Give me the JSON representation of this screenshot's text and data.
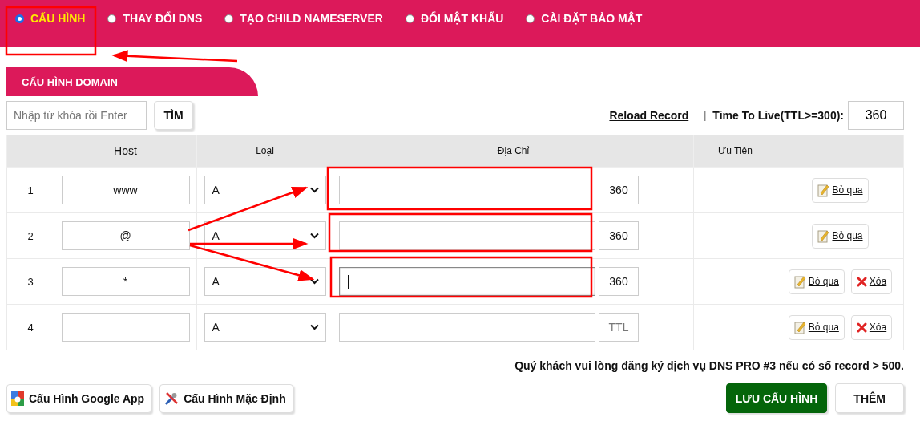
{
  "tabs": [
    {
      "label": "CẤU HÌNH",
      "selected": true
    },
    {
      "label": "THAY ĐỔI DNS",
      "selected": false
    },
    {
      "label": "TẠO CHILD NAMESERVER",
      "selected": false
    },
    {
      "label": "ĐỔI MẬT KHẨU",
      "selected": false
    },
    {
      "label": "CÀI ĐẶT BẢO MẬT",
      "selected": false
    }
  ],
  "section_title": "CẤU HÌNH DOMAIN",
  "search": {
    "placeholder": "Nhập từ khóa rồi Enter",
    "button": "TÌM"
  },
  "reload_link": "Reload Record",
  "separator": "|",
  "ttl_label": "Time To Live(TTL>=300):",
  "ttl_value": "360",
  "table": {
    "columns": [
      "Host",
      "Loại",
      "Địa Chỉ",
      "Ưu Tiên"
    ],
    "rows": [
      {
        "index": "1",
        "host": "www",
        "type": "A",
        "address": "",
        "address_focused": false,
        "ttl": "360",
        "actions": [
          {
            "kind": "skip",
            "label": "Bỏ qua"
          }
        ]
      },
      {
        "index": "2",
        "host": "@",
        "type": "A",
        "address": "",
        "address_focused": false,
        "ttl": "360",
        "actions": [
          {
            "kind": "skip",
            "label": "Bỏ qua"
          }
        ]
      },
      {
        "index": "3",
        "host": "*",
        "type": "A",
        "address": "",
        "address_focused": true,
        "ttl": "360",
        "actions": [
          {
            "kind": "skip",
            "label": "Bỏ qua"
          },
          {
            "kind": "delete",
            "label": "Xóa"
          }
        ]
      },
      {
        "index": "4",
        "host": "",
        "type": "A",
        "address": "",
        "address_focused": false,
        "ttl_placeholder": "TTL",
        "actions": [
          {
            "kind": "skip",
            "label": "Bỏ qua"
          },
          {
            "kind": "delete",
            "label": "Xóa"
          }
        ]
      }
    ]
  },
  "notice": "Quý khách vui lòng đăng ký dịch vụ DNS PRO #3 nếu có số record > 500.",
  "left_buttons": [
    {
      "kind": "google",
      "label": "Cấu Hình Google App"
    },
    {
      "kind": "tools",
      "label": "Cấu Hình Mặc Định"
    }
  ],
  "right_buttons": [
    {
      "kind": "primary",
      "label": "LƯU CẤU HÌNH"
    },
    {
      "kind": "default",
      "label": "THÊM"
    }
  ]
}
